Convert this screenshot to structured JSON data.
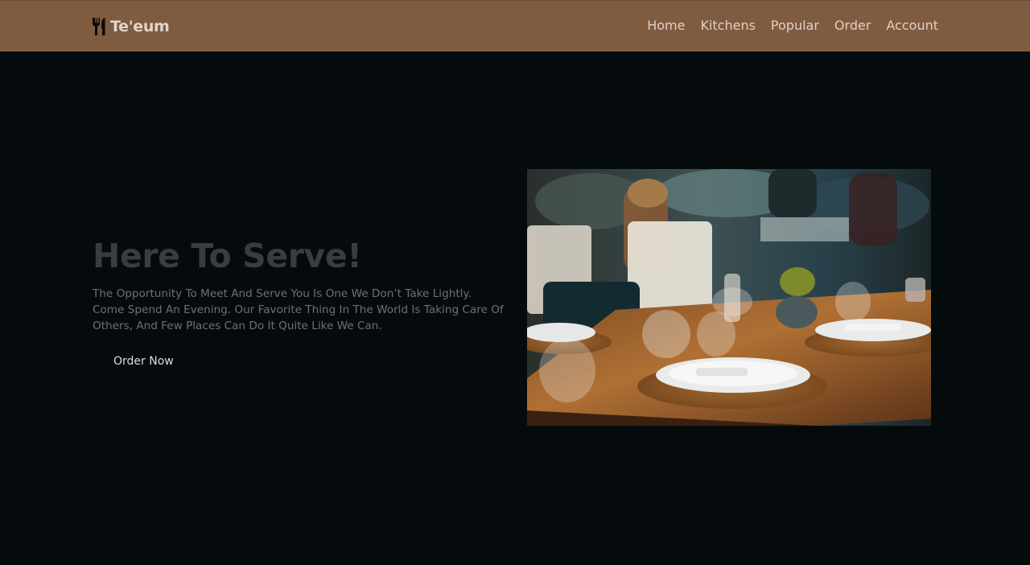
{
  "header": {
    "brand": "Te'eum",
    "brand_icon": "utensils-icon",
    "nav": [
      "Home",
      "Kitchens",
      "Popular",
      "Order",
      "Account"
    ]
  },
  "hero": {
    "title": "Here To Serve!",
    "text": "The Opportunity To Meet And Serve You Is One We Don’t Take Lightly. Come Spend An Evening. Our Favorite Thing In The World Is Taking Care Of Others, And Few Places Can Do It Quite Like We Can.",
    "cta": "Order Now"
  },
  "colors": {
    "header_bg": "#7f5b40",
    "page_bg": "#050b0c",
    "title": "#3a3c3d",
    "body_text": "#6d7071"
  }
}
